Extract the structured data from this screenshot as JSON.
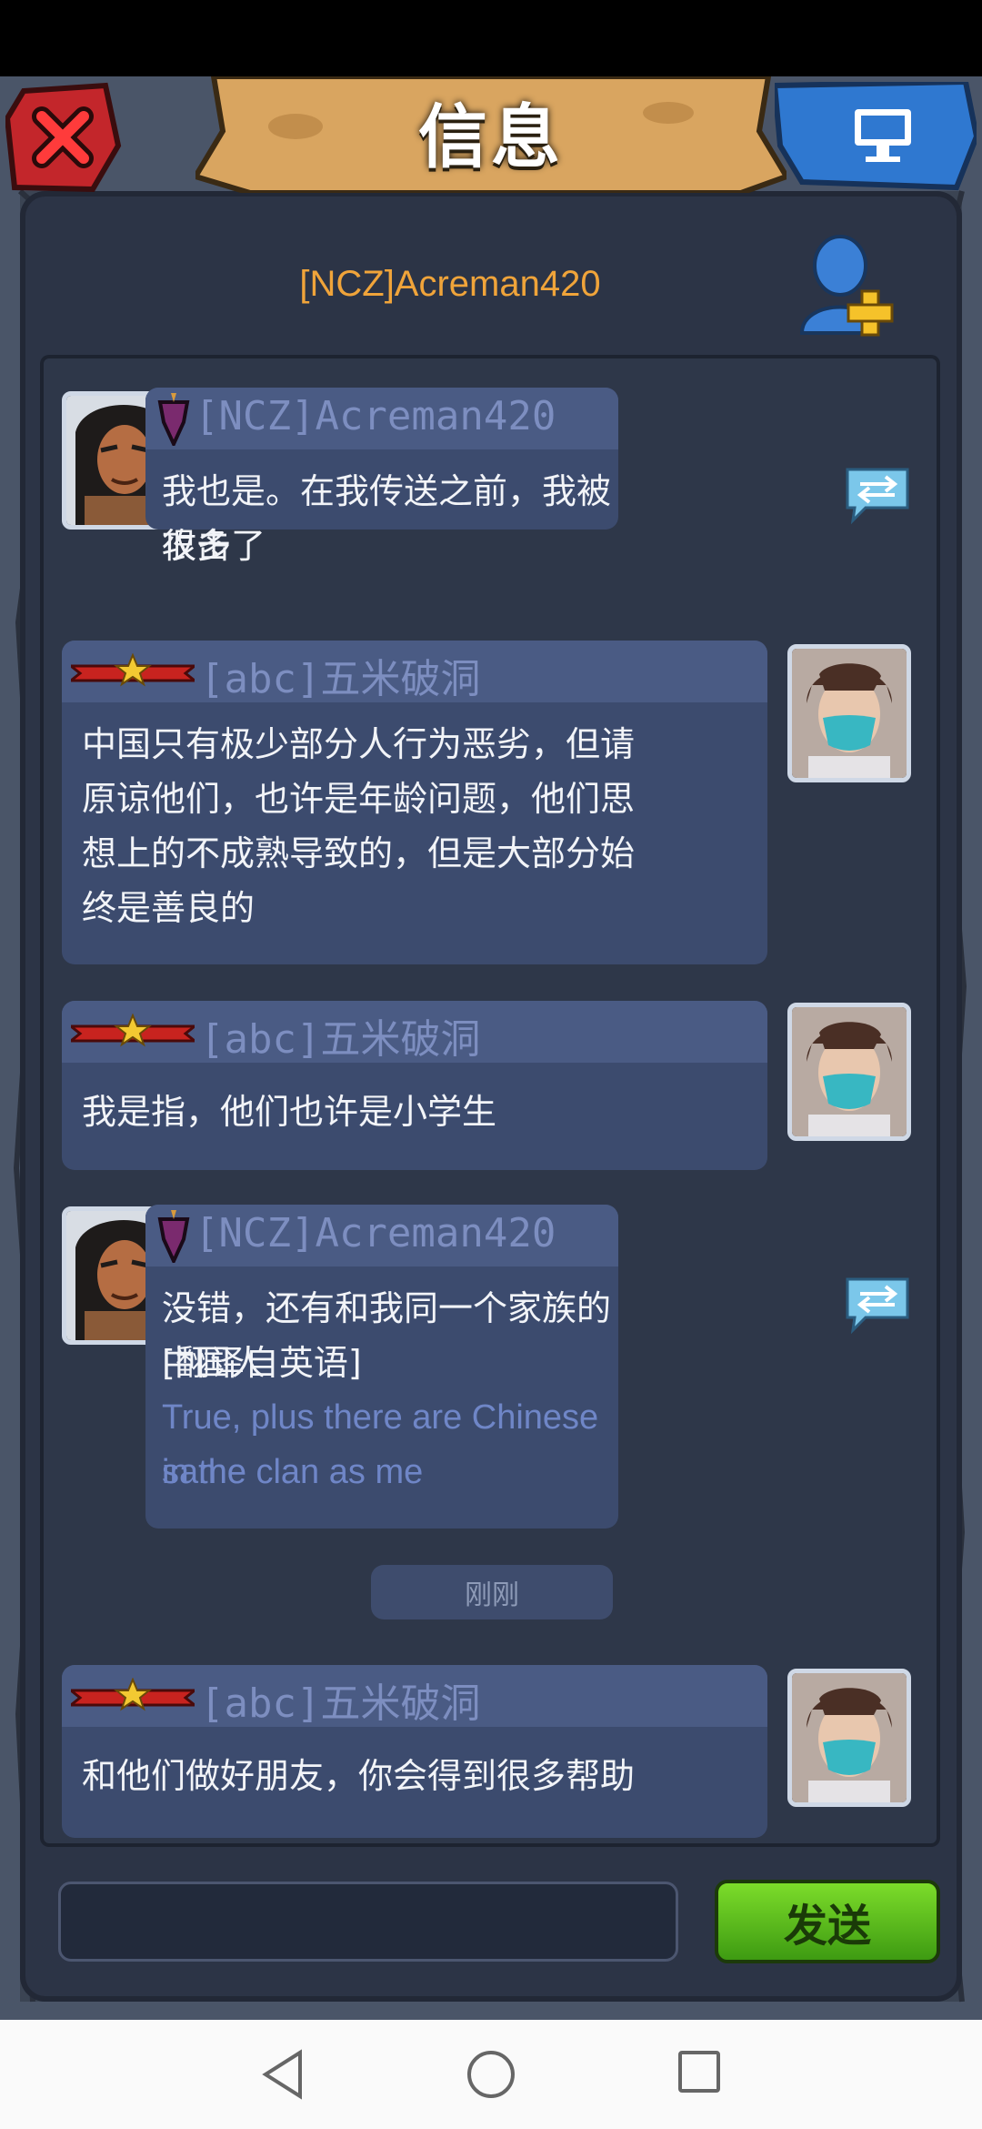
{
  "window": {
    "title": "信息"
  },
  "header": {
    "chat_partner": "[NCZ]Acreman420"
  },
  "messages": [
    {
      "sender": "[NCZ]Acreman420",
      "side": "left",
      "avatar": "warrior-portrait",
      "rank_icon": "purple-shield-icon",
      "lines": [
        "我也是。在我传送之前，我被攻击了",
        "很多"
      ],
      "translatable": true
    },
    {
      "sender": "[abc]五米破洞",
      "side": "right",
      "avatar": "masked-person-photo",
      "rank_icon": "red-star-banner-icon",
      "lines": [
        "中国只有极少部分人行为恶劣，但请",
        "原谅他们，也许是年龄问题，他们思",
        "想上的不成熟导致的，但是大部分始",
        "终是善良的"
      ]
    },
    {
      "sender": "[abc]五米破洞",
      "side": "right",
      "avatar": "masked-person-photo",
      "rank_icon": "red-star-banner-icon",
      "lines": [
        "我是指，他们也许是小学生"
      ]
    },
    {
      "sender": "[NCZ]Acreman420",
      "side": "left",
      "avatar": "warrior-portrait",
      "rank_icon": "purple-shield-icon",
      "lines": [
        "没错，还有和我同一个家族的中国人",
        "[翻译自英语]"
      ],
      "translation_lines": [
        "True, plus there are Chinese in the",
        "same clan as me"
      ],
      "translatable": true
    },
    {
      "sender": "[abc]五米破洞",
      "side": "right",
      "avatar": "masked-person-photo",
      "rank_icon": "red-star-banner-icon",
      "lines": [
        "和他们做好朋友，你会得到很多帮助"
      ]
    }
  ],
  "timestamp": "刚刚",
  "composer": {
    "input_value": "",
    "send_label": "发送"
  },
  "colors": {
    "partner_name": "#f0a43a",
    "sender_name": "#7d8ec0",
    "bubble": "#3c4b6e",
    "send_button": "#5cc01e",
    "translation": "#6f86c7"
  }
}
